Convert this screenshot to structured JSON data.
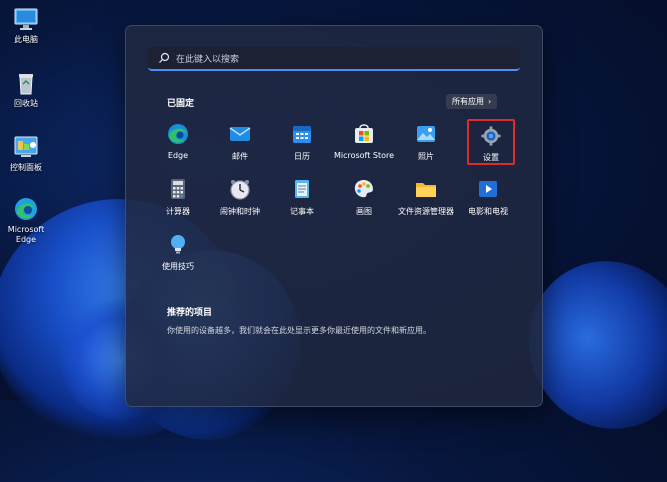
{
  "desktop": {
    "icons": [
      {
        "label": "此电脑",
        "icon": "computer-icon"
      },
      {
        "label": "回收站",
        "icon": "recycle-bin-icon"
      },
      {
        "label": "控制面板",
        "icon": "control-panel-icon"
      },
      {
        "label_line1": "Microsoft",
        "label_line2": "Edge",
        "icon": "edge-icon"
      }
    ]
  },
  "start_menu": {
    "search_placeholder": "在此键入以搜索",
    "pinned_title": "已固定",
    "all_apps_label": "所有应用",
    "pinned_apps": [
      {
        "label": "Edge",
        "icon": "edge-icon"
      },
      {
        "label": "邮件",
        "icon": "mail-icon"
      },
      {
        "label": "日历",
        "icon": "calendar-icon"
      },
      {
        "label": "Microsoft Store",
        "icon": "store-icon"
      },
      {
        "label": "照片",
        "icon": "photos-icon"
      },
      {
        "label": "设置",
        "icon": "settings-icon",
        "highlighted": true
      },
      {
        "label": "计算器",
        "icon": "calculator-icon"
      },
      {
        "label": "闹钟和时钟",
        "icon": "alarm-clock-icon"
      },
      {
        "label": "记事本",
        "icon": "notepad-icon"
      },
      {
        "label": "画图",
        "icon": "paint-icon"
      },
      {
        "label": "文件资源管理器",
        "icon": "folder-icon"
      },
      {
        "label": "电影和电视",
        "icon": "movies-tv-icon"
      },
      {
        "label": "使用技巧",
        "icon": "tips-icon"
      }
    ],
    "recommended_title": "推荐的项目",
    "recommended_desc": "你使用的设备越多，我们就会在此处显示更多你最近使用的文件和新应用。"
  },
  "colors": {
    "accent": "#4c8ff5",
    "highlight_border": "#e02b2b",
    "menu_bg": "#202840"
  }
}
